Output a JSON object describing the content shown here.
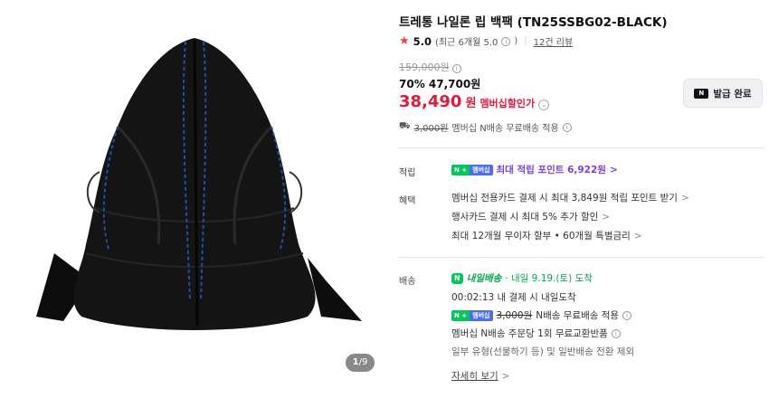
{
  "product": {
    "title": "트레통 나일론 립 백팩 (TN25SSBG02-BLACK)",
    "pager_current": "1",
    "pager_total": "/9"
  },
  "rating": {
    "star": "★",
    "score": "5.0",
    "recent": "(최근 6개월 5.0",
    "recent_close": ")",
    "info": "i",
    "reviews": "12건 리뷰"
  },
  "price": {
    "original": "159,000원",
    "info": "i",
    "discount": "70% 47,700원",
    "member_price": "38,490",
    "member_won": "원",
    "member_label": "멤버십할인가",
    "member_chevron": "⌄"
  },
  "shipping_top": {
    "icon": "⛟",
    "old_fee": "3,000원",
    "text": "멤버십 N배송 무료배송 적용",
    "info": "i"
  },
  "coupon": {
    "card": "N",
    "label": "발급 완료"
  },
  "points": {
    "label": "적립",
    "badge_n": "N +",
    "badge_m": "멤버십",
    "text": "최대 적립 포인트 6,922원",
    "chevron": ">"
  },
  "benefits": {
    "label": "혜택",
    "lines": [
      "멤버십 전용카드 결제 시 최대 3,849원 적립 포인트 받기",
      "행사카드 결제 시 최대 5% 추가 할인",
      "최대 12개월 무이자 할부 • 60개월 특별금리"
    ],
    "chevron": ">"
  },
  "delivery": {
    "label": "배송",
    "npill": "N",
    "tomorrow_label": "내일배송",
    "arrival": "· 내일 9.19.(토) 도착",
    "deadline": "00:02:13 내 결제 시 내일도착",
    "badge_n": "N +",
    "badge_m": "멤버십",
    "old_fee": "3,000원",
    "free_text": "N배송 무료배송 적용",
    "info": "i",
    "return_text": "멤버십 N배송 주문당 1회 무료교환반품",
    "note": "일부 유형(선물하기 등) 및 일반배송 전환 제외",
    "more": "자세히 보기",
    "more_chevron": ">"
  },
  "colors": {
    "accent_red": "#e8163a",
    "naver_green": "#03c75a",
    "point_purple": "#7b3fe4"
  }
}
